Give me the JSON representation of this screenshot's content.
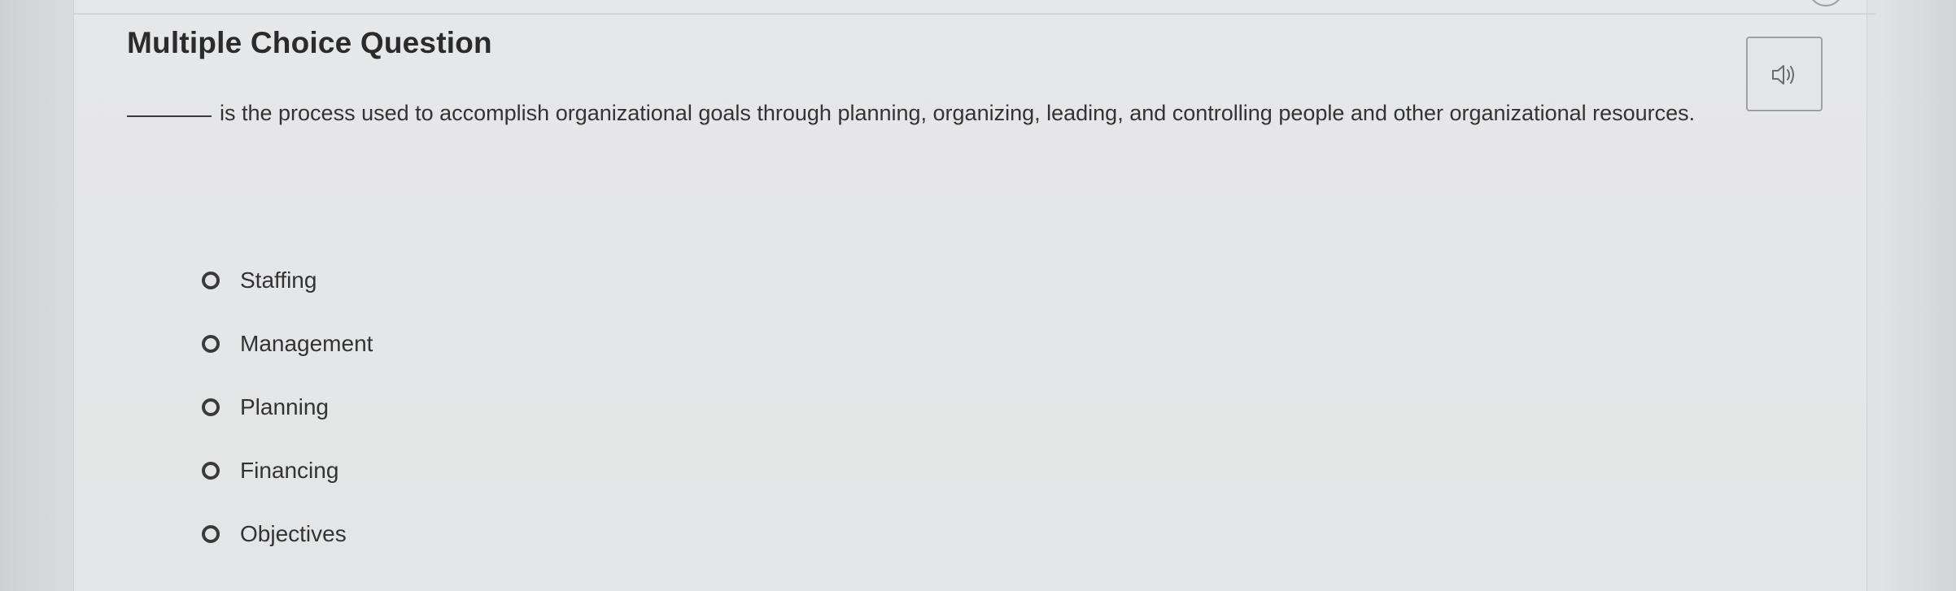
{
  "question": {
    "title": "Multiple Choice Question",
    "prompt": "is the process used to accomplish organizational goals through planning, organizing, leading, and controlling people and other organizational resources.",
    "audio_button_icon": "speaker-icon"
  },
  "options": [
    {
      "label": "Staffing",
      "selected": false
    },
    {
      "label": "Management",
      "selected": false
    },
    {
      "label": "Planning",
      "selected": false
    },
    {
      "label": "Financing",
      "selected": false
    },
    {
      "label": "Objectives",
      "selected": false
    }
  ],
  "colors": {
    "text": "#333333",
    "radio_border": "#3a3a3a",
    "button_border": "#9ea0a2",
    "background": "#e3e4e5"
  }
}
